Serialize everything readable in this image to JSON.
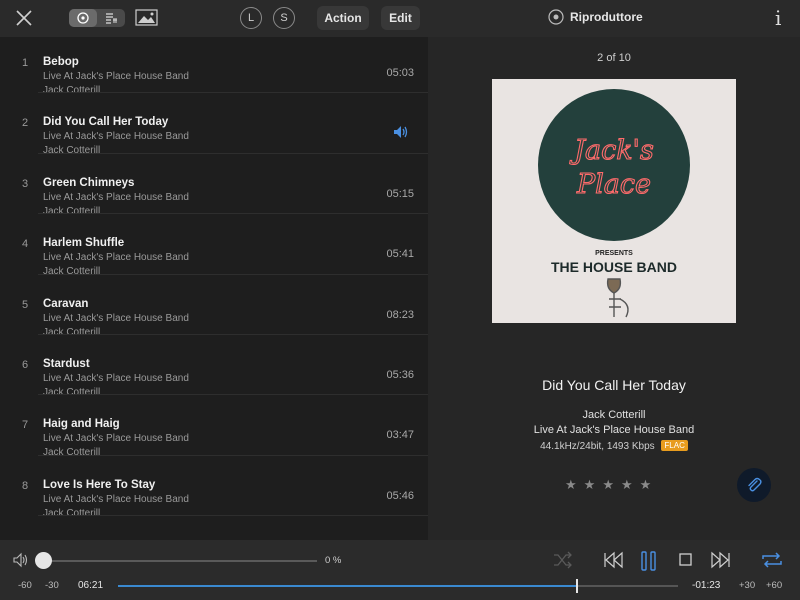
{
  "toolbar": {
    "left_circle": "L",
    "right_circle": "S",
    "action_label": "Action",
    "edit_label": "Edit",
    "player_title": "Riproduttore"
  },
  "tracks": [
    {
      "num": "1",
      "title": "Bebop",
      "album": "Live At Jack's Place House Band",
      "artist": "Jack Cotterill",
      "duration": "05:03",
      "playing": false
    },
    {
      "num": "2",
      "title": "Did You Call Her Today",
      "album": "Live At Jack's Place House Band",
      "artist": "Jack Cotterill",
      "duration": "",
      "playing": true
    },
    {
      "num": "3",
      "title": "Green Chimneys",
      "album": "Live At Jack's Place House Band",
      "artist": "Jack Cotterill",
      "duration": "05:15",
      "playing": false
    },
    {
      "num": "4",
      "title": "Harlem Shuffle",
      "album": "Live At Jack's Place House Band",
      "artist": "Jack Cotterill",
      "duration": "05:41",
      "playing": false
    },
    {
      "num": "5",
      "title": "Caravan",
      "album": "Live At Jack's Place House Band",
      "artist": "Jack Cotterill",
      "duration": "08:23",
      "playing": false
    },
    {
      "num": "6",
      "title": "Stardust",
      "album": "Live At Jack's Place House Band",
      "artist": "Jack Cotterill",
      "duration": "05:36",
      "playing": false
    },
    {
      "num": "7",
      "title": "Haig and Haig",
      "album": "Live At Jack's Place House Band",
      "artist": "Jack Cotterill",
      "duration": "03:47",
      "playing": false
    },
    {
      "num": "8",
      "title": "Love Is Here To Stay",
      "album": "Live At Jack's Place House Band",
      "artist": "Jack Cotterill",
      "duration": "05:46",
      "playing": false
    }
  ],
  "now_playing": {
    "position": "2 of 10",
    "cover_line1": "Jack's",
    "cover_line2": "Place",
    "cover_presents": "PRESENTS",
    "cover_band": "THE HOUSE BAND",
    "song_title": "Did You Call Her Today",
    "artist": "Jack Cotterill",
    "album": "Live At Jack's Place House Band",
    "format": "44.1kHz/24bit, 1493 Kbps",
    "codec_badge": "FLAC",
    "rating": 0,
    "rating_max": 5
  },
  "transport": {
    "volume_percent_label": "0 %",
    "volume_level": 0,
    "elapsed": "06:21",
    "remaining": "-01:23",
    "progress": 0.82,
    "seek_back_60": "-60",
    "seek_back_30": "-30",
    "seek_fwd_30": "+30",
    "seek_fwd_60": "+60"
  },
  "colors": {
    "accent": "#3a89d0",
    "flac_badge": "#e89c1e",
    "neon": "#ff5a5a",
    "cover_circle": "#23403c"
  },
  "icons": {
    "close": "close-icon",
    "speaker": "speaker-icon",
    "shuffle": "shuffle-icon",
    "prev": "previous-track-icon",
    "pause": "pause-icon",
    "stop": "stop-icon",
    "next": "next-track-icon",
    "repeat": "repeat-icon",
    "attach": "paperclip-icon"
  }
}
